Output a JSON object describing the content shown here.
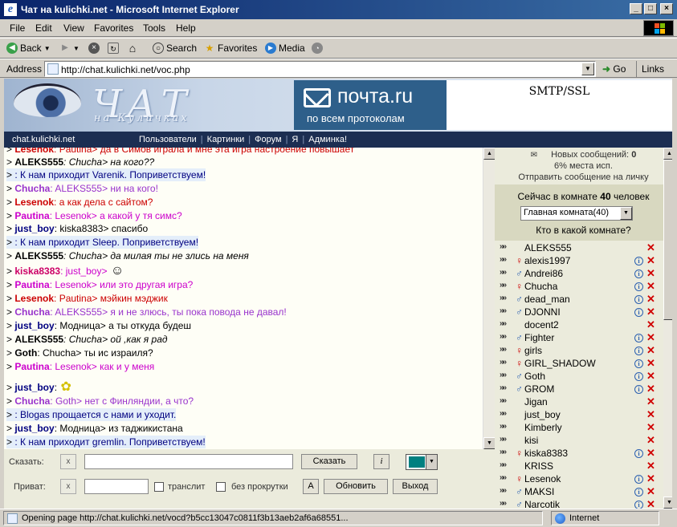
{
  "window": {
    "title": "Чат на kulichki.net - Microsoft Internet Explorer"
  },
  "menu": [
    "File",
    "Edit",
    "View",
    "Favorites",
    "Tools",
    "Help"
  ],
  "toolbar": {
    "back": "Back",
    "search": "Search",
    "favorites": "Favorites",
    "media": "Media"
  },
  "address": {
    "label": "Address",
    "url": "http://chat.kulichki.net/voc.php",
    "go": "Go",
    "links": "Links"
  },
  "banner": {
    "logo": "ЧАТ",
    "logo_sub": "на Куличках",
    "site": "chat.kulichki.net",
    "ad_title": "почта.ru",
    "ad_sub": "по всем протоколам",
    "ad_right": "SMTP/SSL"
  },
  "nav": [
    "Пользователи",
    "Картинки",
    "Форум",
    "Я",
    "Админка!"
  ],
  "messages": [
    {
      "nick": "Lesenok",
      "text": ": Pautina> да в Симов играла и мне эта игра настроение повышает",
      "nick_color": "#cc0000",
      "text_color": "#cc0000"
    },
    {
      "nick": "ALEKS555",
      "text": ": Chucha> на кого??",
      "nick_color": "#000000",
      "text_color": "#000000",
      "italic": true
    },
    {
      "nick": "",
      "text": ": К нам приходит Varenik. Поприветствуем!",
      "nick_color": "#000000",
      "text_color": "#000080",
      "sys": true
    },
    {
      "nick": "Chucha",
      "text": ": ALEKS555> ни на кого!",
      "nick_color": "#9933cc",
      "text_color": "#9933cc"
    },
    {
      "nick": "Lesenok",
      "text": ": а как дела с сайтом?",
      "nick_color": "#cc0000",
      "text_color": "#cc0000"
    },
    {
      "nick": "Pautina",
      "text": ": Lesenok> а какой у тя симс?",
      "nick_color": "#cc00cc",
      "text_color": "#cc00cc"
    },
    {
      "nick": "just_boy",
      "text": ": kiska8383> спасибо",
      "nick_color": "#000080",
      "text_color": "#000000"
    },
    {
      "nick": "",
      "text": ": К нам приходит Sleep. Поприветствуем!",
      "nick_color": "#000000",
      "text_color": "#000080",
      "sys": true
    },
    {
      "nick": "ALEKS555",
      "text": ": Chucha> да милая ты не злись на меня",
      "nick_color": "#000000",
      "text_color": "#000000",
      "italic": true
    },
    {
      "nick": "kiska8383",
      "text": ": just_boy>",
      "nick_color": "#cc0066",
      "text_color": "#cc00cc",
      "smile": true
    },
    {
      "nick": "Pautina",
      "text": ": Lesenok> или это другая игра?",
      "nick_color": "#cc00cc",
      "text_color": "#cc00cc"
    },
    {
      "nick": "Lesenok",
      "text": ": Pautina> мэйкин мэджик",
      "nick_color": "#cc0000",
      "text_color": "#cc0000"
    },
    {
      "nick": "Chucha",
      "text": ": ALEKS555> я и не злюсь, ты пока повода не давал!",
      "nick_color": "#9933cc",
      "text_color": "#9933cc"
    },
    {
      "nick": "just_boy",
      "text": ": Модница> а ты откуда будеш",
      "nick_color": "#000080",
      "text_color": "#000000"
    },
    {
      "nick": "ALEKS555",
      "text": ": Chucha> ой ,как я рад",
      "nick_color": "#000000",
      "text_color": "#000000",
      "italic": true
    },
    {
      "nick": "Goth",
      "text": ": Chucha> ты ис израиля?",
      "nick_color": "#000000",
      "text_color": "#000000"
    },
    {
      "nick": "Pautina",
      "text": ": Lesenok> как и у меня",
      "nick_color": "#cc00cc",
      "text_color": "#cc00cc"
    },
    {
      "nick": "just_boy",
      "text": ":",
      "nick_color": "#000080",
      "text_color": "#000000",
      "flower": true
    },
    {
      "nick": "Chucha",
      "text": ": Goth> нет с Финляндии, а что?",
      "nick_color": "#9933cc",
      "text_color": "#9933cc"
    },
    {
      "nick": "",
      "text": ": Blogas прощается с нами и уходит.",
      "nick_color": "#000000",
      "text_color": "#000080",
      "sys": true
    },
    {
      "nick": "just_boy",
      "text": ": Модница> из таджикистана",
      "nick_color": "#000080",
      "text_color": "#000000"
    },
    {
      "nick": "",
      "text": ": К нам приходит gremlin. Поприветствуем!",
      "nick_color": "#000000",
      "text_color": "#000080",
      "sys": true
    }
  ],
  "info": {
    "new_messages_label": "Новых сообщений:",
    "new_messages": "0",
    "space": "6% места исп.",
    "send_private": "Отправить сообщение на личку"
  },
  "room": {
    "count_prefix": "Сейчас в комнате",
    "count": "40",
    "count_suffix": "человек",
    "selected": "Главная комната(40)",
    "where": "Кто в какой комнате?"
  },
  "users": [
    {
      "name": "ALEKS555",
      "sex": "",
      "info": false
    },
    {
      "name": "alexis1997",
      "sex": "f",
      "info": true
    },
    {
      "name": "Andrei86",
      "sex": "m",
      "info": true
    },
    {
      "name": "Chucha",
      "sex": "f",
      "info": true
    },
    {
      "name": "dead_man",
      "sex": "m",
      "info": true
    },
    {
      "name": "DJONNI",
      "sex": "m",
      "info": true
    },
    {
      "name": "docent2",
      "sex": "",
      "info": false
    },
    {
      "name": "Fighter",
      "sex": "m",
      "info": true
    },
    {
      "name": "girls",
      "sex": "f",
      "info": true
    },
    {
      "name": "GIRL_SHADOW",
      "sex": "f",
      "info": true
    },
    {
      "name": "Goth",
      "sex": "m",
      "info": true
    },
    {
      "name": "GROM",
      "sex": "m",
      "info": true
    },
    {
      "name": "Jigan",
      "sex": "",
      "info": false
    },
    {
      "name": "just_boy",
      "sex": "",
      "info": false
    },
    {
      "name": "Kimberly",
      "sex": "",
      "info": false
    },
    {
      "name": "kisi",
      "sex": "",
      "info": false
    },
    {
      "name": "kiska8383",
      "sex": "f",
      "info": true
    },
    {
      "name": "KRISS",
      "sex": "",
      "info": false
    },
    {
      "name": "Lesenok",
      "sex": "f",
      "info": true
    },
    {
      "name": "MAKSI",
      "sex": "m",
      "info": true
    },
    {
      "name": "Narcotik",
      "sex": "m",
      "info": true
    }
  ],
  "input": {
    "say_label": "Сказать:",
    "say_button": "Сказать",
    "italic_button": "i",
    "clear": "x",
    "private_label": "Приват:",
    "translit": "транслит",
    "noscroll": "без прокрутки",
    "a_button": "А",
    "refresh": "Обновить",
    "exit": "Выход",
    "color": "#008080"
  },
  "status": {
    "text": "Opening page http://chat.kulichki.net/vocd?b5cc13047c0811f3b13aeb2af6a68551...",
    "zone": "Internet"
  }
}
